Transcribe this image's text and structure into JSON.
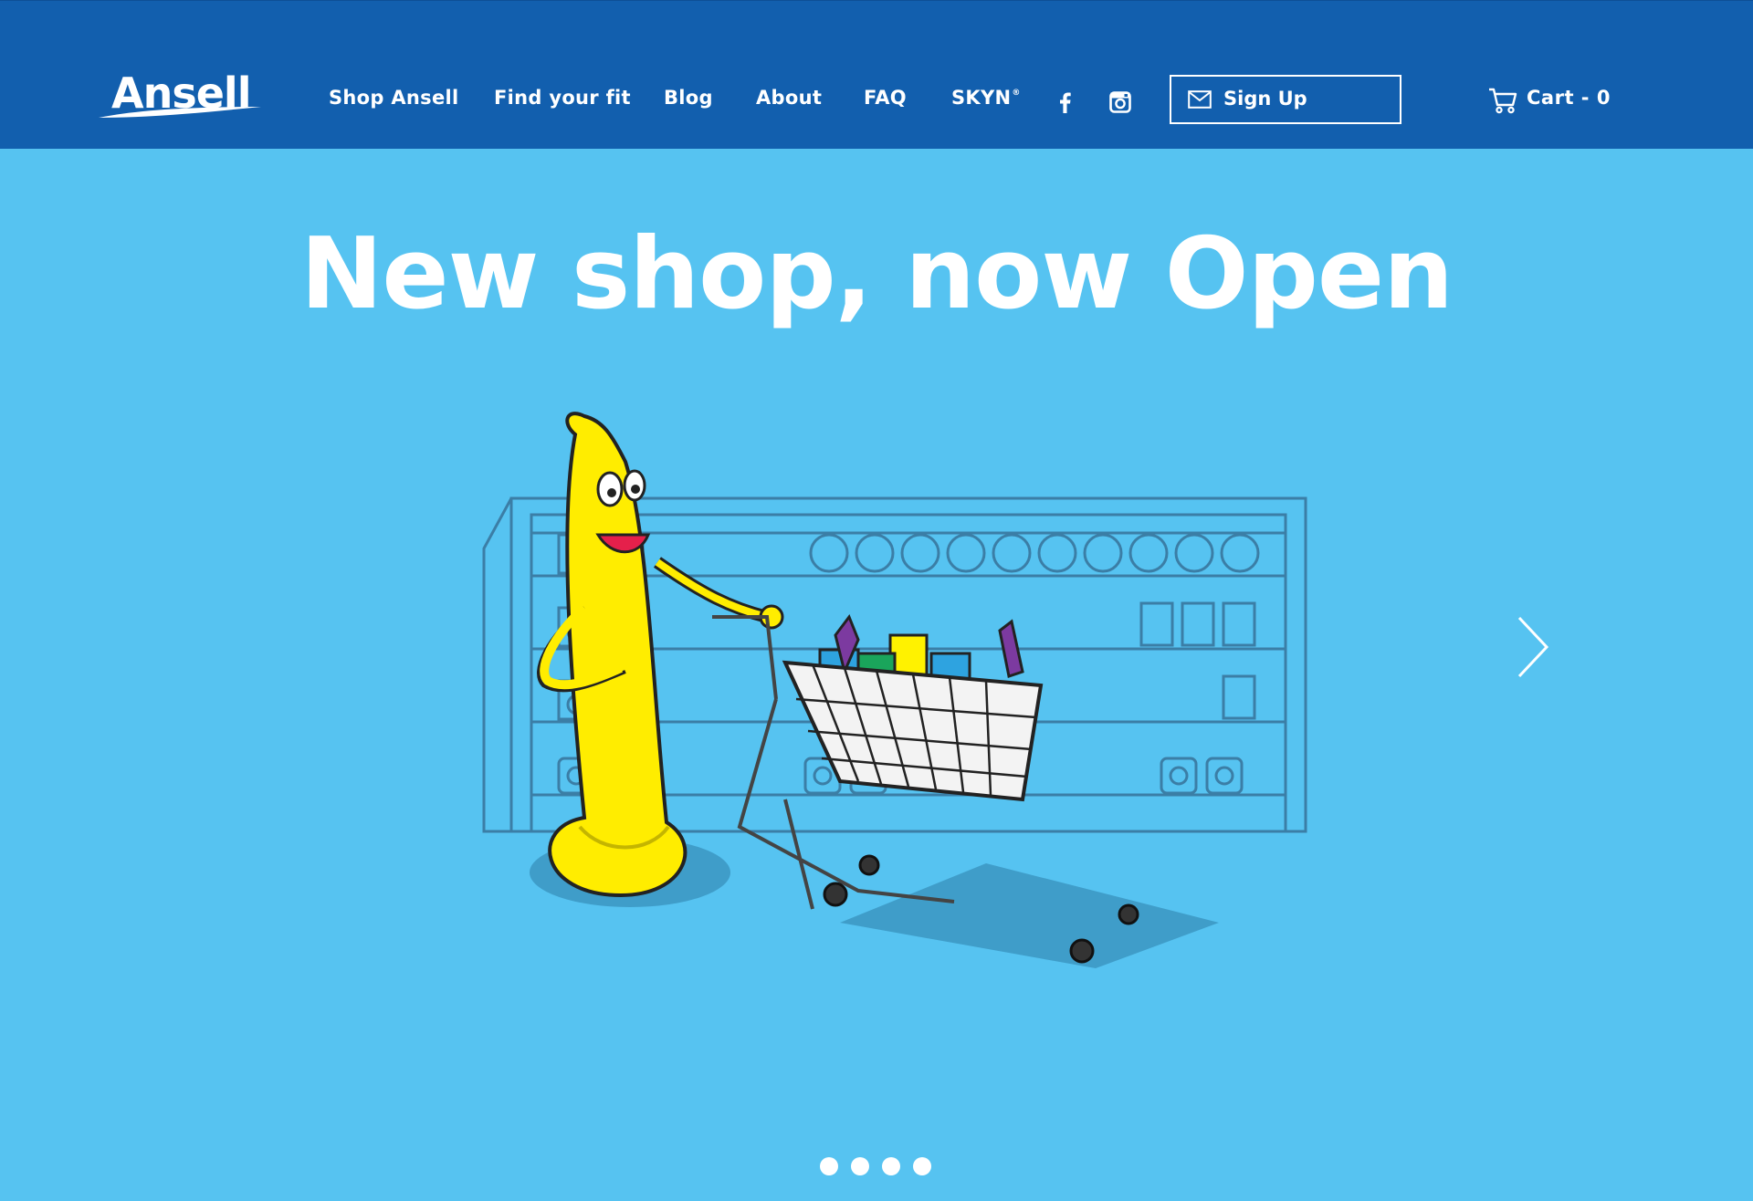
{
  "brand": {
    "name": "Ansell"
  },
  "nav": {
    "shop": "Shop Ansell",
    "fit": "Find your fit",
    "blog": "Blog",
    "about": "About",
    "faq": "FAQ",
    "skyn": "SKYN",
    "skyn_mark": "®"
  },
  "social": {
    "facebook_icon": "facebook-icon",
    "instagram_icon": "instagram-icon"
  },
  "signup": {
    "label": "Sign Up",
    "icon": "mail-icon"
  },
  "cart": {
    "label": "Cart -  0",
    "icon": "cart-icon"
  },
  "hero": {
    "title": "New shop, now Open",
    "slide_count": 4,
    "active_slide": 1
  },
  "colors": {
    "header_bg": "#125fae",
    "page_bg": "#56c3f1",
    "mascot_yellow": "#ffed00",
    "text": "#ffffff"
  }
}
